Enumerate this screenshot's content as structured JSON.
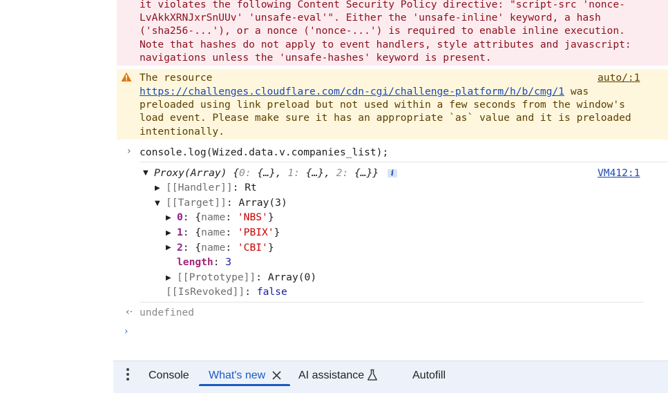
{
  "csp_error": {
    "lines": [
      "it violates the following Content Security Policy directive: \"script-src 'nonce-",
      "LvAkkXRNJxrSnUUv' 'unsafe-eval'\". Either the 'unsafe-inline' keyword, a hash",
      "('sha256-...'), or a nonce ('nonce-...') is required to enable inline execution.",
      "Note that hashes do not apply to event handlers, style attributes and javascript:",
      "navigations unless the 'unsafe-hashes' keyword is present."
    ]
  },
  "preload_warning": {
    "prefix": "The resource",
    "source": "auto/:1",
    "url": "https://challenges.cloudflare.com/cdn-cgi/challenge-platform/h/b/cmg/1",
    "url_suffix": " was",
    "lines": [
      "preloaded using link preload but not used within a few seconds from the window's",
      "load event. Please make sure it has an appropriate `as` value and it is preloaded",
      "intentionally."
    ]
  },
  "command": {
    "text": "console.log(Wized.data.v.companies_list);"
  },
  "proxy_output": {
    "summary": {
      "type": "Proxy(Array)",
      "open": " {",
      "i0": "0",
      "i1": "1",
      "i2": "2",
      "ellipsis": "{…}",
      "close": "}",
      "source": "VM412:1",
      "info": "i"
    },
    "handler": {
      "label": "[[Handler]]",
      "value": "Rt"
    },
    "target": {
      "label": "[[Target]]",
      "value": "Array(3)"
    },
    "items": [
      {
        "index": "0",
        "key": "name",
        "value": "'NBS'"
      },
      {
        "index": "1",
        "key": "name",
        "value": "'PBIX'"
      },
      {
        "index": "2",
        "key": "name",
        "value": "'CBI'"
      }
    ],
    "length": {
      "label": "length",
      "value": "3"
    },
    "prototype": {
      "label": "[[Prototype]]",
      "value": "Array(0)"
    },
    "revoked": {
      "label": "[[IsRevoked]]",
      "value": "false"
    }
  },
  "return_value": "undefined",
  "drawer": {
    "tabs": [
      {
        "label": "Console"
      },
      {
        "label": "What's new"
      },
      {
        "label": "AI assistance"
      },
      {
        "label": "Autofill"
      }
    ]
  },
  "colors": {
    "error_bg": "#fdecef",
    "warning_bg": "#fef7dd",
    "link": "#1a48b4",
    "drawer_bg": "#edf2fa",
    "active_tab": "#1a5ac2"
  }
}
